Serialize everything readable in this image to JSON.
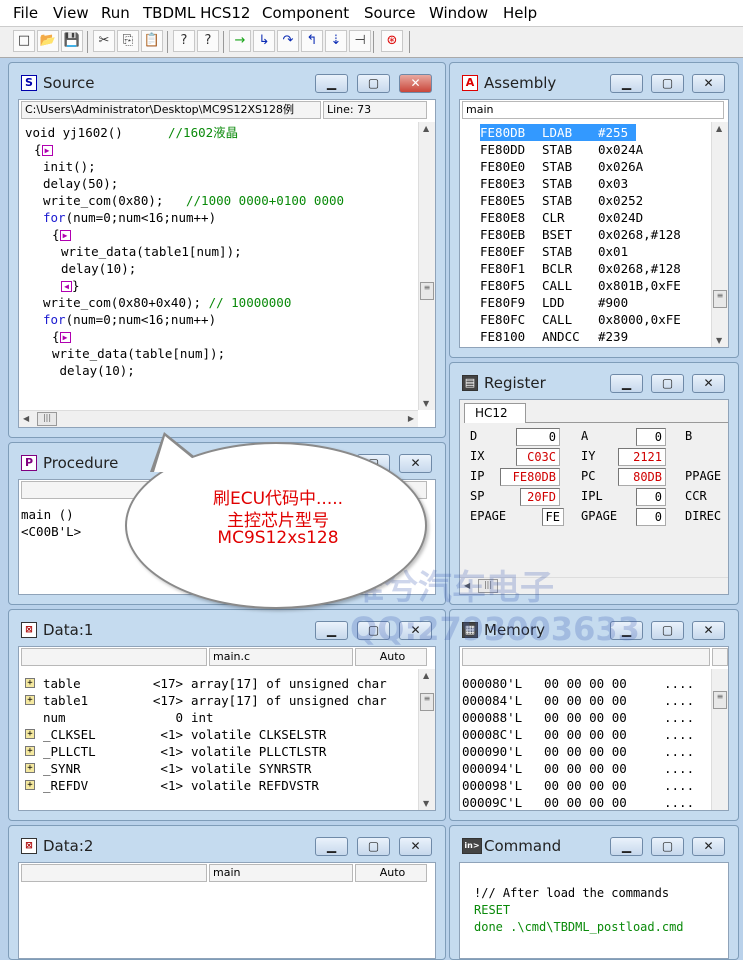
{
  "menu": [
    "File",
    "View",
    "Run",
    "TBDML HCS12",
    "Component",
    "Source",
    "Window",
    "Help"
  ],
  "toolbar": {
    "icons": [
      "new-icon",
      "open-icon",
      "save-icon",
      "cut-icon",
      "copy-icon",
      "paste-icon",
      "help-icon",
      "context-help-icon",
      "start-icon",
      "step-icon",
      "step-over-icon",
      "step-out-icon",
      "assembly-step-icon",
      "halt-icon",
      "reset-icon"
    ],
    "glyphs": [
      "□",
      "📂",
      "💾",
      "✂",
      "⎘",
      "📋",
      "?",
      "?",
      "→",
      "↳",
      "↷",
      "↰",
      "⇣",
      "⊣",
      "⊛"
    ]
  },
  "source": {
    "title": "Source",
    "path": "C:\\Users\\Administrator\\Desktop\\MC9S12XS128例",
    "line": "Line: 73",
    "lines": [
      {
        "t": "void yj1602()      ",
        "c": "//1602液晶",
        "i": 0
      },
      {
        "m": "▶",
        "b": "{",
        "i": 1
      },
      {
        "t": "init();",
        "i": 2
      },
      {
        "t": "delay(50);",
        "i": 2
      },
      {
        "t": "write_com(0x80);   ",
        "c": "//1000 0000+0100 0000",
        "i": 2
      },
      {
        "k": "for",
        "t": "(num=0;num<16;num++)",
        "i": 2
      },
      {
        "m": "▶",
        "b": "{",
        "i": 3
      },
      {
        "t": "write_data(table1[num]);",
        "i": 4
      },
      {
        "t": "delay(10);",
        "i": 4
      },
      {
        "m": "◀",
        "a": "}",
        "i": 4
      },
      {
        "t": "write_com(0x80+0x40); ",
        "c": "// 10000000",
        "i": 2
      },
      {
        "k": "for",
        "t": "(num=0;num<16;num++)",
        "i": 2
      },
      {
        "m": "▶",
        "b": "{",
        "i": 3
      },
      {
        "t": "write_data(table[num]);",
        "i": 3
      },
      {
        "t": " delay(10);",
        "i": 3
      },
      {
        "t": "",
        "i": 3
      },
      {
        "m": "◀",
        "a": "}",
        "i": 4
      }
    ]
  },
  "assembly": {
    "title": "Assembly",
    "field": "main",
    "rows": [
      [
        "FE80DB",
        "LDAB",
        "#255"
      ],
      [
        "FE80DD",
        "STAB",
        "0x024A"
      ],
      [
        "FE80E0",
        "STAB",
        "0x026A"
      ],
      [
        "FE80E3",
        "STAB",
        "0x03"
      ],
      [
        "FE80E5",
        "STAB",
        "0x0252"
      ],
      [
        "FE80E8",
        "CLR",
        "0x024D"
      ],
      [
        "FE80EB",
        "BSET",
        "0x0268,#128"
      ],
      [
        "FE80EF",
        "STAB",
        "0x01"
      ],
      [
        "FE80F1",
        "BCLR",
        "0x0268,#128"
      ],
      [
        "FE80F5",
        "CALL",
        "0x801B,0xFE"
      ],
      [
        "FE80F9",
        "LDD",
        "#900"
      ],
      [
        "FE80FC",
        "CALL",
        "0x8000,0xFE"
      ],
      [
        "FE8100",
        "ANDCC",
        "#239"
      ]
    ]
  },
  "procedure": {
    "title": "Procedure",
    "items": [
      "main ()",
      "<C00B'L>"
    ]
  },
  "register": {
    "title": "Register",
    "tab": "HC12",
    "regs": [
      {
        "l": "D",
        "v": "0",
        "red": false
      },
      {
        "l": "A",
        "v": "0",
        "red": false
      },
      {
        "l": "B",
        "v": "",
        "red": false
      },
      {
        "l": "IX",
        "v": "C03C",
        "red": true
      },
      {
        "l": "IY",
        "v": "2121",
        "red": true
      },
      {
        "l": "IP",
        "v": "FE80DB",
        "red": true
      },
      {
        "l": "PC",
        "v": "80DB",
        "red": true
      },
      {
        "l": "PPAGE",
        "v": "",
        "red": false
      },
      {
        "l": "SP",
        "v": "20FD",
        "red": true
      },
      {
        "l": "IPL",
        "v": "0",
        "red": false
      },
      {
        "l": "CCR",
        "v": "",
        "red": false
      },
      {
        "l": "EPAGE",
        "v": "FE",
        "red": false
      },
      {
        "l": "GPAGE",
        "v": "0",
        "red": false
      },
      {
        "l": "DIREC",
        "v": "",
        "red": false
      }
    ]
  },
  "data1": {
    "title": "Data:1",
    "module": "main.c",
    "mode": "Auto",
    "rows": [
      {
        "plus": true,
        "n": "table",
        "s": "<17>",
        "v": "array[17] of unsigned char"
      },
      {
        "plus": true,
        "n": "table1",
        "s": "<17>",
        "v": "array[17] of unsigned char"
      },
      {
        "plus": false,
        "n": "num",
        "s": "0",
        "v": "int"
      },
      {
        "plus": true,
        "n": "_CLKSEL",
        "s": "<1>",
        "v": "volatile CLKSELSTR"
      },
      {
        "plus": true,
        "n": "_PLLCTL",
        "s": "<1>",
        "v": "volatile PLLCTLSTR"
      },
      {
        "plus": true,
        "n": "_SYNR",
        "s": "<1>",
        "v": "volatile SYNRSTR"
      },
      {
        "plus": true,
        "n": "_REFDV",
        "s": "<1>",
        "v": "volatile REFDVSTR"
      }
    ]
  },
  "memory": {
    "title": "Memory",
    "rows": [
      "000080'L",
      "000084'L",
      "000088'L",
      "00008C'L",
      "000090'L",
      "000094'L",
      "000098'L",
      "00009C'L"
    ],
    "bytes": "00 00 00 00",
    "ascii": "...."
  },
  "data2": {
    "title": "Data:2",
    "module": "main",
    "mode": "Auto"
  },
  "command": {
    "title": "Command",
    "lines": [
      "!// After load the commands",
      "RESET",
      "done .\\cmd\\TBDML_postload.cmd"
    ]
  },
  "bubble": {
    "lines": [
      "刷ECU代码中.....",
      "主控芯片型号",
      "MC9S12xs128"
    ]
  },
  "watermark": {
    "line1": "唯兮汽车电子",
    "line2": "QQ:2793003633"
  },
  "colors": {
    "selection": "#3399ff",
    "changed_register": "#d00000",
    "bubble_text": "#e00000"
  }
}
